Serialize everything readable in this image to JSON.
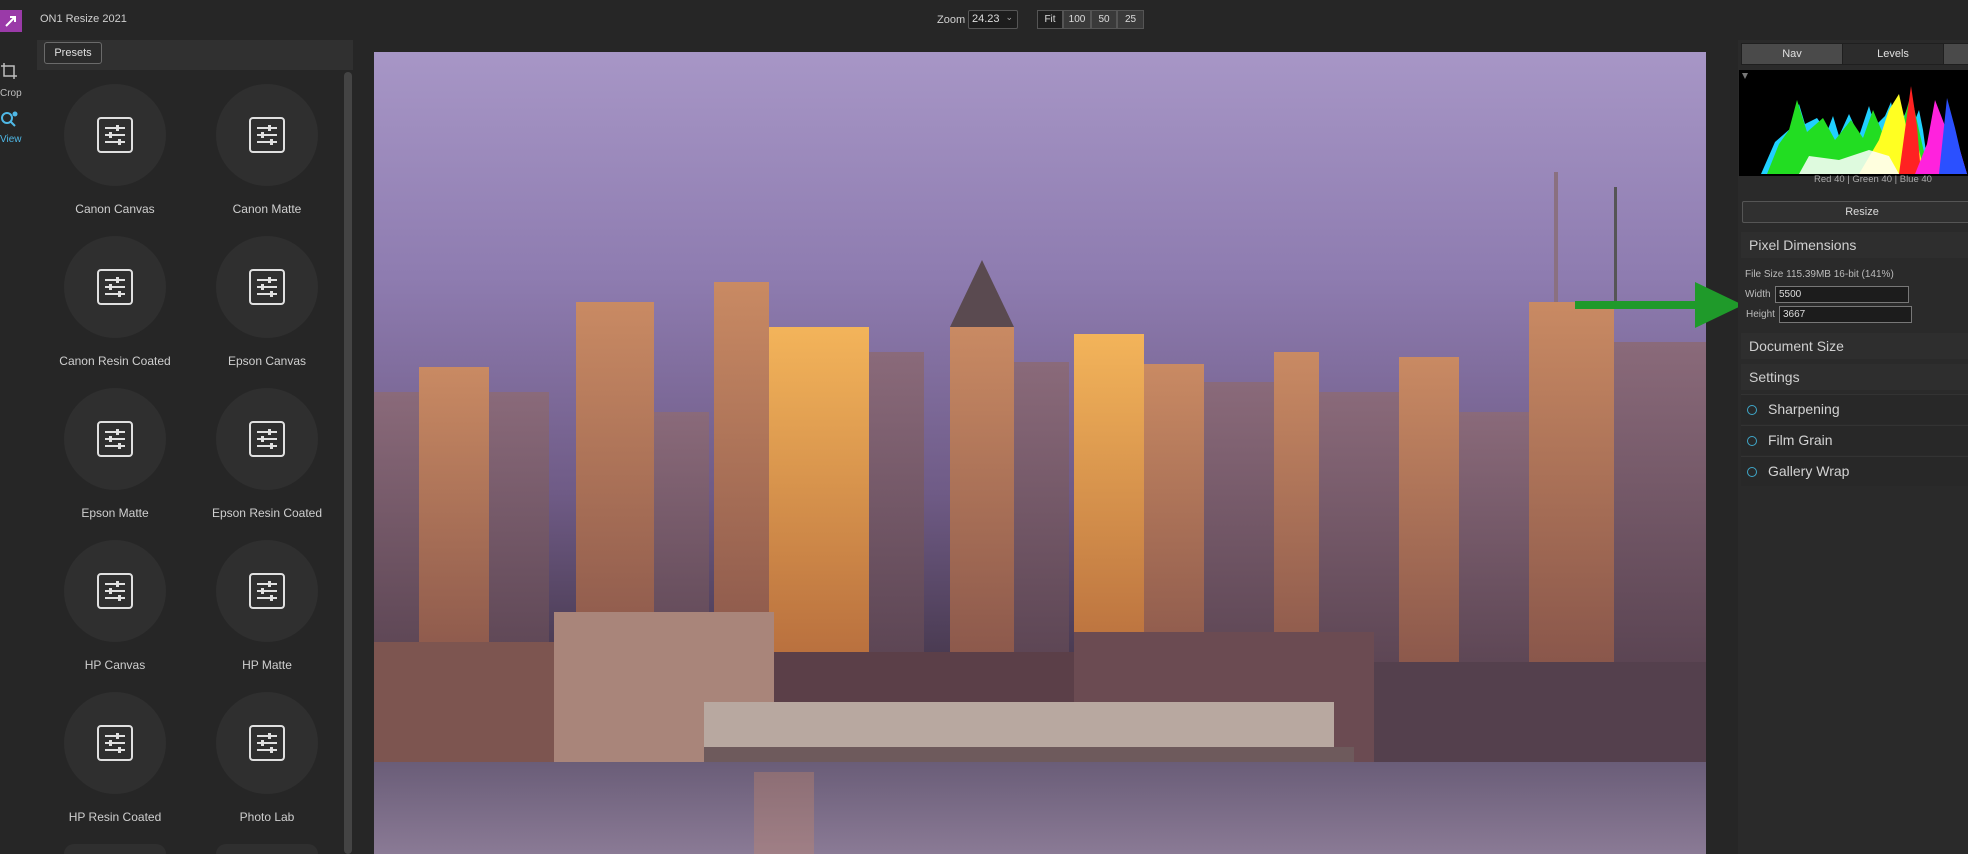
{
  "app": {
    "title": "ON1 Resize 2021",
    "logo_icon": "app-logo-icon"
  },
  "toolbar": {
    "zoom_label": "Zoom",
    "zoom_value": "24.23",
    "zoom_buttons": [
      "Fit",
      "100",
      "50",
      "25"
    ]
  },
  "tools": [
    {
      "label": "Crop",
      "icon": "crop-icon"
    },
    {
      "label": "View",
      "icon": "view-magnifier-icon",
      "active": true
    }
  ],
  "presets": {
    "button_label": "Presets",
    "items": [
      {
        "label": "Canon Canvas"
      },
      {
        "label": "Canon Matte"
      },
      {
        "label": "Canon Resin Coated"
      },
      {
        "label": "Epson Canvas"
      },
      {
        "label": "Epson Matte"
      },
      {
        "label": "Epson Resin Coated"
      },
      {
        "label": "HP Canvas"
      },
      {
        "label": "HP Matte"
      },
      {
        "label": "HP Resin Coated"
      },
      {
        "label": "Photo Lab"
      }
    ],
    "icon": "preset-sliders-icon"
  },
  "right_panel": {
    "tabs": [
      "Nav",
      "Levels"
    ],
    "active_tab": "Nav",
    "histogram_readout": "Red  40   | Green  40   | Blue  40",
    "resize_button": "Resize",
    "pixel_dimensions": {
      "title": "Pixel Dimensions",
      "file_size": "File Size 115.39MB 16-bit (141%)",
      "width_label": "Width",
      "width_value": "5500",
      "height_label": "Height",
      "height_value": "3667"
    },
    "document_size_title": "Document Size",
    "settings_title": "Settings",
    "settings_items": [
      "Sharpening",
      "Film Grain",
      "Gallery Wrap"
    ]
  },
  "colors": {
    "accent": "#4fb8e6",
    "logo": "#9a3aa8",
    "annotation_arrow": "#1f9a2a",
    "background": "#262626"
  }
}
